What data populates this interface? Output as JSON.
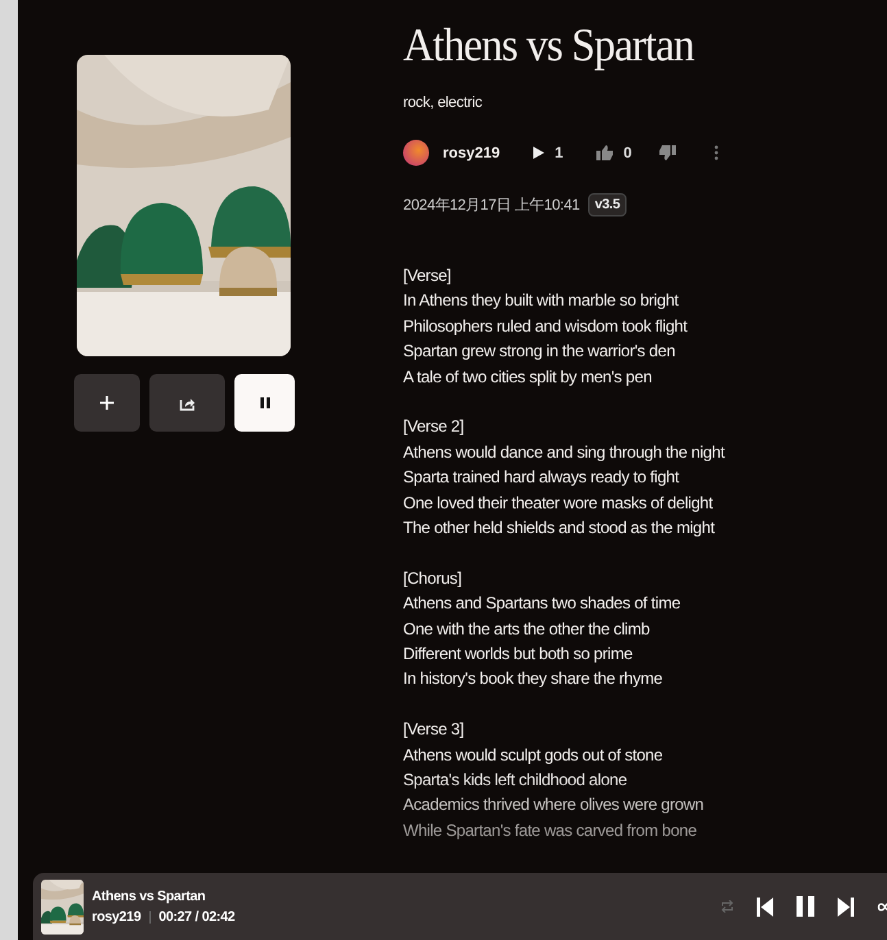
{
  "song": {
    "title": "Athens vs Spartan",
    "tags": "rock, electric",
    "author": "rosy219",
    "plays": "1",
    "likes": "0",
    "date": "2024年12月17日 上午10:41",
    "version": "v3.5",
    "playing": true
  },
  "lyrics": [
    {
      "heading": "[Verse]",
      "lines": [
        "In Athens they built with marble so bright",
        "Philosophers ruled and wisdom took flight",
        "Spartan grew strong in the warrior's den",
        "A tale of two cities split by men's pen"
      ]
    },
    {
      "heading": "[Verse 2]",
      "lines": [
        "Athens would dance and sing through the night",
        "Sparta trained hard always ready to fight",
        "One loved their theater wore masks of delight",
        "The other held shields and stood as the might"
      ]
    },
    {
      "heading": "[Chorus]",
      "lines": [
        "Athens and Spartans two shades of time",
        "One with the arts the other the climb",
        "Different worlds but both so prime",
        "In history's book they share the rhyme"
      ]
    },
    {
      "heading": "[Verse 3]",
      "lines": [
        "Athens would sculpt gods out of stone",
        "Sparta's kids left childhood alone",
        "Academics thrived where olives were grown",
        "While Spartan's fate was carved from bone"
      ]
    }
  ],
  "player": {
    "title": "Athens vs Spartan",
    "artist": "rosy219",
    "time": "00:27 / 02:42",
    "playing": true
  }
}
